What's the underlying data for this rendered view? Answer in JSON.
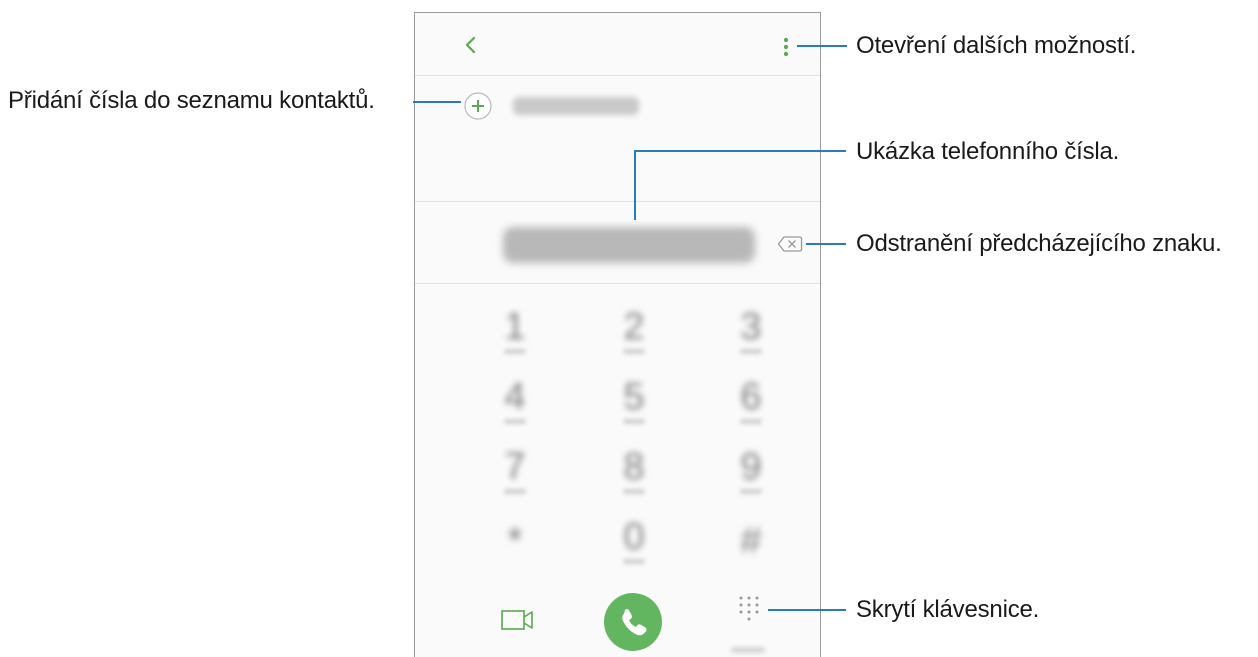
{
  "callouts": {
    "more_options": "Otevření dalších možností.",
    "add_to_contacts": "Přidání čísla do seznamu kontaktů.",
    "number_preview": "Ukázka telefonního čísla.",
    "delete_char": "Odstranění předcházejícího znaku.",
    "hide_keypad": "Skrytí klávesnice."
  },
  "keypad": {
    "keys": [
      "1",
      "2",
      "3",
      "4",
      "5",
      "6",
      "7",
      "8",
      "9",
      "*",
      "0",
      "#"
    ]
  },
  "colors": {
    "accent": "#63b660",
    "callout_line": "#2b7bb9",
    "icon_green": "#5aa84f"
  },
  "icons": {
    "back": "chevron-left-icon",
    "more": "more-vertical-icon",
    "add": "plus-circle-icon",
    "backspace": "backspace-icon",
    "video": "video-call-icon",
    "call": "phone-icon",
    "keypad": "dialpad-icon"
  }
}
